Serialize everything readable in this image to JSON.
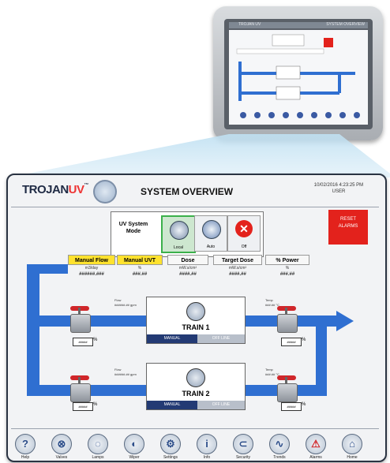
{
  "device_screen": {
    "title_left": "TROJAN UV",
    "title_right": "SYSTEM OVERVIEW"
  },
  "header": {
    "brand_main": "TROJAN",
    "brand_accent": "UV",
    "brand_tm": "™",
    "title": "SYSTEM OVERVIEW",
    "datetime": "10/02/2016 4:23:25 PM",
    "user": "USER"
  },
  "mode": {
    "label_line1": "UV System",
    "label_line2": "Mode",
    "buttons": [
      "Local",
      "Auto",
      "Off"
    ],
    "selected": "Local"
  },
  "reset": {
    "line1": "RESET",
    "line2": "ALARMS",
    "color": "#e3221c"
  },
  "info_table": {
    "headers": [
      "Manual Flow",
      "Manual UVT",
      "Dose",
      "Target Dose",
      "% Power"
    ],
    "units": [
      "m3/day",
      "%",
      "mW.s/cm²",
      "mW.s/cm²",
      "%"
    ],
    "values": [
      "######.###",
      "###.##",
      "####.##",
      "####.##",
      "###.##"
    ]
  },
  "trains": [
    {
      "name": "TRAIN 1",
      "manual": "MANUAL",
      "off": "OFF LINE",
      "flow_label": "Flow",
      "flow_value": "######.## gpm",
      "temp_label": "Temp",
      "temp_value": "###.## °C",
      "inlet_pct": "#####",
      "outlet_pct": "#####",
      "pct_symbol": "%"
    },
    {
      "name": "TRAIN 2",
      "manual": "MANUAL",
      "off": "OFF LINE",
      "flow_label": "Flow",
      "flow_value": "######.## gpm",
      "temp_label": "Temp",
      "temp_value": "###.## °C",
      "inlet_pct": "#####",
      "outlet_pct": "#####",
      "pct_symbol": "%"
    }
  ],
  "footer": [
    {
      "label": "Help",
      "icon": "help-icon",
      "glyph": "?"
    },
    {
      "label": "Valves",
      "icon": "valve-icon",
      "glyph": "⊗"
    },
    {
      "label": "Lamps",
      "icon": "lamps-icon",
      "glyph": "◌"
    },
    {
      "label": "Wiper",
      "icon": "wiper-icon",
      "glyph": "◐"
    },
    {
      "label": "Settings",
      "icon": "settings-icon",
      "glyph": "⚙"
    },
    {
      "label": "Info",
      "icon": "info-icon",
      "glyph": "i"
    },
    {
      "label": "Security",
      "icon": "security-icon",
      "glyph": "⊂"
    },
    {
      "label": "Trends",
      "icon": "trends-icon",
      "glyph": "∿"
    },
    {
      "label": "Alarms",
      "icon": "alarms-icon",
      "glyph": "⚠"
    },
    {
      "label": "Home",
      "icon": "home-icon",
      "glyph": "⌂"
    }
  ],
  "colors": {
    "pipe": "#2f6fd1",
    "highlight_yellow": "#ffe22e",
    "local_green": "#3bb04b",
    "train_manual": "#233a74"
  }
}
